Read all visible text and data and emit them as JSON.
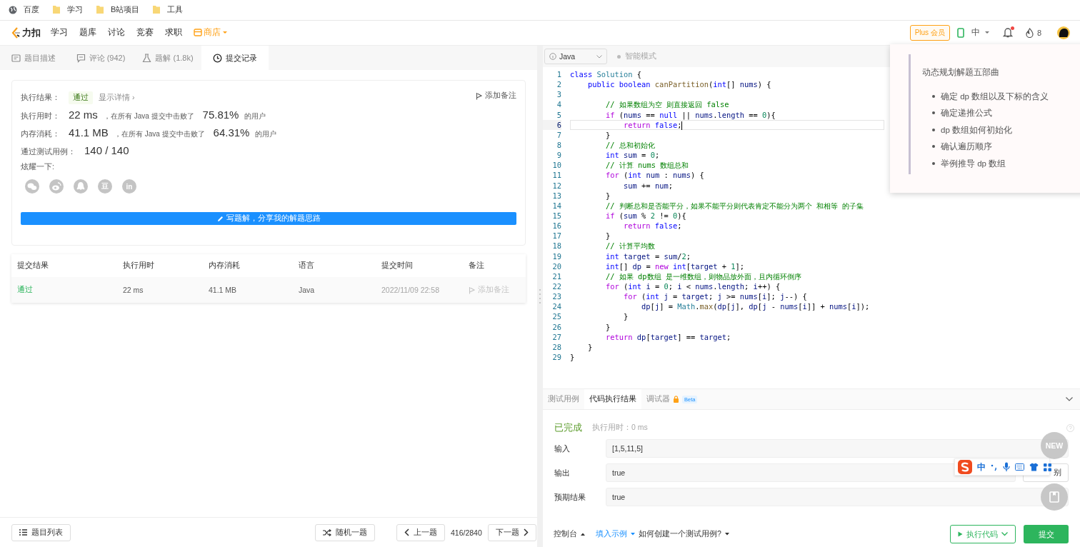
{
  "bookmarks": [
    {
      "label": "百度",
      "kind": "site"
    },
    {
      "label": "学习",
      "kind": "folder"
    },
    {
      "label": "B站项目",
      "kind": "folder"
    },
    {
      "label": "工具",
      "kind": "folder"
    }
  ],
  "nav": {
    "logo": "力扣",
    "items": [
      {
        "label": "学习",
        "kind": "link"
      },
      {
        "label": "题库",
        "kind": "link"
      },
      {
        "label": "讨论",
        "kind": "link"
      },
      {
        "label": "竞赛",
        "kind": "link"
      },
      {
        "label": "求职",
        "kind": "link"
      },
      {
        "label": "商店",
        "kind": "store"
      }
    ],
    "plus": "Plus 会员",
    "lang": "中",
    "notification_dot": true,
    "streak": "8"
  },
  "left_tabs": [
    {
      "label": "题目描述",
      "selected": false
    },
    {
      "label": "评论 (942)",
      "selected": false
    },
    {
      "label": "题解 (1.8k)",
      "selected": false
    },
    {
      "label": "提交记录",
      "selected": true
    }
  ],
  "result": {
    "status_label": "执行结果：",
    "status": "通过",
    "details": "显示详情 ›",
    "note": "添加备注",
    "runtime": {
      "label": "执行用时：",
      "value": "22 ms",
      "text": "，在所有 Java 提交中击败了",
      "percent": "75.81%",
      "suffix": "的用户"
    },
    "memory": {
      "label": "内存消耗：",
      "value": "41.1 MB",
      "text": "，在所有 Java 提交中击败了",
      "percent": "64.31%",
      "suffix": "的用户"
    },
    "tests": {
      "label": "通过测试用例：",
      "value": "140 / 140"
    },
    "share_label": "炫耀一下:",
    "share": [
      {
        "kind": "wechat"
      },
      {
        "kind": "weibo"
      },
      {
        "kind": "qq"
      },
      {
        "kind": "glyph",
        "glyph": "豆"
      },
      {
        "kind": "glyph",
        "glyph": "in"
      }
    ],
    "write_button": "写题解，分享我的解题思路"
  },
  "table": {
    "columns": [
      "提交结果",
      "执行用时",
      "内存消耗",
      "语言",
      "提交时间",
      "备注"
    ],
    "rows": [
      {
        "status": "通过",
        "runtime": "22 ms",
        "memory": "41.1 MB",
        "language": "Java",
        "time": "2022/11/09 22:58",
        "note": "添加备注"
      }
    ]
  },
  "left_footer": {
    "list": "题目列表",
    "random": "随机一题",
    "prev": "上一题",
    "counter": "416/2840",
    "next": "下一题"
  },
  "editor": {
    "language": "Java",
    "mode": "智能模式",
    "lines": [
      {
        "n": "1",
        "active": false,
        "tokens": [
          {
            "kind": "keyword",
            "text": "class"
          },
          {
            "kind": "type",
            "text": " Solution"
          },
          {
            "kind": "plain",
            "text": " {"
          }
        ]
      },
      {
        "n": "2",
        "active": false,
        "tokens": [
          {
            "kind": "keyword",
            "text": "    public boolean"
          },
          {
            "kind": "function",
            "text": " canPartition"
          },
          {
            "kind": "plain",
            "text": "("
          },
          {
            "kind": "keyword",
            "text": "int"
          },
          {
            "kind": "plain",
            "text": "[] "
          },
          {
            "kind": "variable",
            "text": "nums"
          },
          {
            "kind": "plain",
            "text": ") {"
          }
        ]
      },
      {
        "n": "3",
        "active": false
      },
      {
        "n": "4",
        "active": false,
        "tokens": [
          {
            "kind": "comment",
            "text": "        // 如果数组为空 则直接返回 false"
          }
        ]
      },
      {
        "n": "5",
        "active": false,
        "tokens": [
          {
            "kind": "control",
            "text": "        if"
          },
          {
            "kind": "plain",
            "text": " ("
          },
          {
            "kind": "variable",
            "text": "nums"
          },
          {
            "kind": "plain",
            "text": " == "
          },
          {
            "kind": "keyword",
            "text": "null"
          },
          {
            "kind": "plain",
            "text": " || "
          },
          {
            "kind": "variable",
            "text": "nums"
          },
          {
            "kind": "plain",
            "text": "."
          },
          {
            "kind": "variable",
            "text": "length"
          },
          {
            "kind": "plain",
            "text": " == "
          },
          {
            "kind": "number",
            "text": "0"
          },
          {
            "kind": "plain",
            "text": "){"
          }
        ]
      },
      {
        "n": "6",
        "active": true,
        "tokens": [
          {
            "kind": "control",
            "text": "            return"
          },
          {
            "kind": "keyword",
            "text": " false"
          },
          {
            "kind": "plain",
            "text": ";"
          }
        ]
      },
      {
        "n": "7",
        "active": false,
        "tokens": [
          {
            "kind": "plain",
            "text": "        }"
          }
        ]
      },
      {
        "n": "8",
        "active": false,
        "tokens": [
          {
            "kind": "comment",
            "text": "        // 总和初始化"
          }
        ]
      },
      {
        "n": "9",
        "active": false,
        "tokens": [
          {
            "kind": "keyword",
            "text": "        int"
          },
          {
            "kind": "variable",
            "text": " sum"
          },
          {
            "kind": "plain",
            "text": " = "
          },
          {
            "kind": "number",
            "text": "0"
          },
          {
            "kind": "plain",
            "text": ";"
          }
        ]
      },
      {
        "n": "10",
        "active": false,
        "tokens": [
          {
            "kind": "comment",
            "text": "        // 计算 nums 数组总和"
          }
        ]
      },
      {
        "n": "11",
        "active": false,
        "tokens": [
          {
            "kind": "control",
            "text": "        for"
          },
          {
            "kind": "plain",
            "text": " ("
          },
          {
            "kind": "keyword",
            "text": "int"
          },
          {
            "kind": "variable",
            "text": " num"
          },
          {
            "kind": "plain",
            "text": " : "
          },
          {
            "kind": "variable",
            "text": "nums"
          },
          {
            "kind": "plain",
            "text": ") {"
          }
        ]
      },
      {
        "n": "12",
        "active": false,
        "tokens": [
          {
            "kind": "variable",
            "text": "            sum"
          },
          {
            "kind": "plain",
            "text": " += "
          },
          {
            "kind": "variable",
            "text": "num"
          },
          {
            "kind": "plain",
            "text": ";"
          }
        ]
      },
      {
        "n": "13",
        "active": false,
        "tokens": [
          {
            "kind": "plain",
            "text": "        }"
          }
        ]
      },
      {
        "n": "14",
        "active": false,
        "tokens": [
          {
            "kind": "comment",
            "text": "        // 判断总和是否能平分，如果不能平分则代表肯定不能分为两个 和相等 的子集"
          }
        ]
      },
      {
        "n": "15",
        "active": false,
        "tokens": [
          {
            "kind": "control",
            "text": "        if"
          },
          {
            "kind": "plain",
            "text": " ("
          },
          {
            "kind": "variable",
            "text": "sum"
          },
          {
            "kind": "plain",
            "text": " % "
          },
          {
            "kind": "number",
            "text": "2"
          },
          {
            "kind": "plain",
            "text": " != "
          },
          {
            "kind": "number",
            "text": "0"
          },
          {
            "kind": "plain",
            "text": "){"
          }
        ]
      },
      {
        "n": "16",
        "active": false,
        "tokens": [
          {
            "kind": "control",
            "text": "            return"
          },
          {
            "kind": "keyword",
            "text": " false"
          },
          {
            "kind": "plain",
            "text": ";"
          }
        ]
      },
      {
        "n": "17",
        "active": false,
        "tokens": [
          {
            "kind": "plain",
            "text": "        }"
          }
        ]
      },
      {
        "n": "18",
        "active": false,
        "tokens": [
          {
            "kind": "comment",
            "text": "        // 计算平均数"
          }
        ]
      },
      {
        "n": "19",
        "active": false,
        "tokens": [
          {
            "kind": "keyword",
            "text": "        int"
          },
          {
            "kind": "variable",
            "text": " target"
          },
          {
            "kind": "plain",
            "text": " = "
          },
          {
            "kind": "variable",
            "text": "sum"
          },
          {
            "kind": "plain",
            "text": "/"
          },
          {
            "kind": "number",
            "text": "2"
          },
          {
            "kind": "plain",
            "text": ";"
          }
        ]
      },
      {
        "n": "20",
        "active": false,
        "tokens": [
          {
            "kind": "keyword",
            "text": "        int"
          },
          {
            "kind": "plain",
            "text": "[] "
          },
          {
            "kind": "variable",
            "text": "dp"
          },
          {
            "kind": "plain",
            "text": " = "
          },
          {
            "kind": "control",
            "text": "new"
          },
          {
            "kind": "keyword",
            "text": " int"
          },
          {
            "kind": "plain",
            "text": "["
          },
          {
            "kind": "variable",
            "text": "target"
          },
          {
            "kind": "plain",
            "text": " + "
          },
          {
            "kind": "number",
            "text": "1"
          },
          {
            "kind": "plain",
            "text": "];"
          }
        ]
      },
      {
        "n": "21",
        "active": false,
        "tokens": [
          {
            "kind": "comment",
            "text": "        // 如果 dp数组 是一维数组，则物品放外面，且内循环倒序"
          }
        ]
      },
      {
        "n": "22",
        "active": false,
        "tokens": [
          {
            "kind": "control",
            "text": "        for"
          },
          {
            "kind": "plain",
            "text": " ("
          },
          {
            "kind": "keyword",
            "text": "int"
          },
          {
            "kind": "variable",
            "text": " i"
          },
          {
            "kind": "plain",
            "text": " = "
          },
          {
            "kind": "number",
            "text": "0"
          },
          {
            "kind": "plain",
            "text": "; "
          },
          {
            "kind": "variable",
            "text": "i"
          },
          {
            "kind": "plain",
            "text": " < "
          },
          {
            "kind": "variable",
            "text": "nums"
          },
          {
            "kind": "plain",
            "text": "."
          },
          {
            "kind": "variable",
            "text": "length"
          },
          {
            "kind": "plain",
            "text": "; "
          },
          {
            "kind": "variable",
            "text": "i"
          },
          {
            "kind": "plain",
            "text": "++) {"
          }
        ]
      },
      {
        "n": "23",
        "active": false,
        "tokens": [
          {
            "kind": "control",
            "text": "            for"
          },
          {
            "kind": "plain",
            "text": " ("
          },
          {
            "kind": "keyword",
            "text": "int"
          },
          {
            "kind": "variable",
            "text": " j"
          },
          {
            "kind": "plain",
            "text": " = "
          },
          {
            "kind": "variable",
            "text": "target"
          },
          {
            "kind": "plain",
            "text": "; "
          },
          {
            "kind": "variable",
            "text": "j"
          },
          {
            "kind": "plain",
            "text": " >= "
          },
          {
            "kind": "variable",
            "text": "nums"
          },
          {
            "kind": "plain",
            "text": "["
          },
          {
            "kind": "variable",
            "text": "i"
          },
          {
            "kind": "plain",
            "text": "]; "
          },
          {
            "kind": "variable",
            "text": "j"
          },
          {
            "kind": "plain",
            "text": "--) {"
          }
        ]
      },
      {
        "n": "24",
        "active": false,
        "tokens": [
          {
            "kind": "variable",
            "text": "                dp"
          },
          {
            "kind": "plain",
            "text": "["
          },
          {
            "kind": "variable",
            "text": "j"
          },
          {
            "kind": "plain",
            "text": "] = "
          },
          {
            "kind": "type",
            "text": "Math"
          },
          {
            "kind": "plain",
            "text": "."
          },
          {
            "kind": "function",
            "text": "max"
          },
          {
            "kind": "plain",
            "text": "("
          },
          {
            "kind": "variable",
            "text": "dp"
          },
          {
            "kind": "plain",
            "text": "["
          },
          {
            "kind": "variable",
            "text": "j"
          },
          {
            "kind": "plain",
            "text": "], "
          },
          {
            "kind": "variable",
            "text": "dp"
          },
          {
            "kind": "plain",
            "text": "["
          },
          {
            "kind": "variable",
            "text": "j"
          },
          {
            "kind": "plain",
            "text": " - "
          },
          {
            "kind": "variable",
            "text": "nums"
          },
          {
            "kind": "plain",
            "text": "["
          },
          {
            "kind": "variable",
            "text": "i"
          },
          {
            "kind": "plain",
            "text": "]] + "
          },
          {
            "kind": "variable",
            "text": "nums"
          },
          {
            "kind": "plain",
            "text": "["
          },
          {
            "kind": "variable",
            "text": "i"
          },
          {
            "kind": "plain",
            "text": "]);"
          }
        ]
      },
      {
        "n": "25",
        "active": false,
        "tokens": [
          {
            "kind": "plain",
            "text": "            }"
          }
        ]
      },
      {
        "n": "26",
        "active": false,
        "tokens": [
          {
            "kind": "plain",
            "text": "        }"
          }
        ]
      },
      {
        "n": "27",
        "active": false,
        "tokens": [
          {
            "kind": "control",
            "text": "        return"
          },
          {
            "kind": "variable",
            "text": " dp"
          },
          {
            "kind": "plain",
            "text": "["
          },
          {
            "kind": "variable",
            "text": "target"
          },
          {
            "kind": "plain",
            "text": "] == "
          },
          {
            "kind": "variable",
            "text": "target"
          },
          {
            "kind": "plain",
            "text": ";"
          }
        ]
      },
      {
        "n": "28",
        "active": false,
        "tokens": [
          {
            "kind": "plain",
            "text": "    }"
          }
        ]
      },
      {
        "n": "29",
        "active": false,
        "tokens": [
          {
            "kind": "plain",
            "text": "}"
          }
        ]
      }
    ]
  },
  "popup": {
    "title": "动态规划解题五部曲",
    "items": [
      "确定 dp 数组以及下标的含义",
      "确定递推公式",
      "dp 数组如何初始化",
      "确认遍历顺序",
      "举例推导 dp 数组"
    ]
  },
  "console": {
    "tabs": [
      {
        "label": "测试用例",
        "selected": false,
        "locked": false
      },
      {
        "label": "代码执行结果",
        "selected": true,
        "locked": false
      },
      {
        "label": "调试器",
        "selected": false,
        "locked": true,
        "badge": "Beta"
      }
    ],
    "status": "已完成",
    "runtime": "执行用时：0 ms",
    "fields": [
      {
        "label": "输入",
        "value": "[1,5,11,5]"
      },
      {
        "label": "输出",
        "value": "true"
      },
      {
        "label": "预期结果",
        "value": "true"
      }
    ],
    "diff_button": "别",
    "footer": {
      "console": "控制台",
      "example": "填入示例",
      "howto": "如何创建一个测试用例?",
      "run": "执行代码",
      "submit": "提交"
    }
  },
  "floating": {
    "new": "NEW"
  },
  "ime": {
    "lang": "中"
  }
}
